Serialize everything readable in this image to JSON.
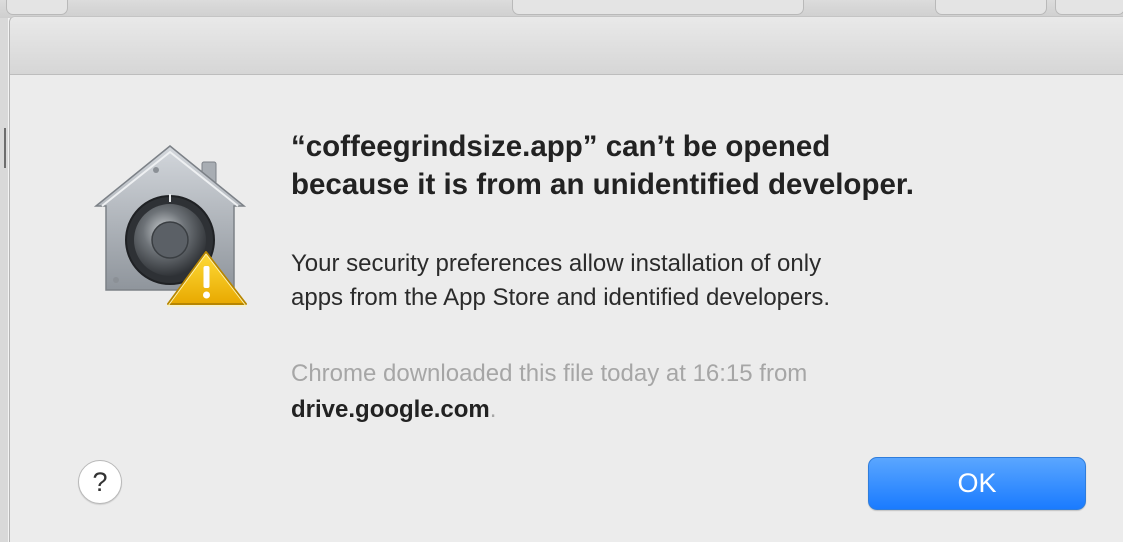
{
  "dialog": {
    "title_line_1": "“coffeegrindsize.app” can’t be opened",
    "title_line_2": "because it is from an unidentified developer.",
    "message_line_1": "Your security preferences allow installation of only",
    "message_line_2": "apps from the App Store and identified developers.",
    "source_line_1": "Chrome downloaded this file today at 16:15 from",
    "source_domain": "drive.google.com",
    "source_suffix": ".",
    "help_label": "?",
    "ok_label": "OK",
    "icon": "gatekeeper-warning-icon"
  },
  "colors": {
    "ok_button": "#1a7bff",
    "warning": "#f5c400",
    "dialog_background": "#ececec"
  }
}
